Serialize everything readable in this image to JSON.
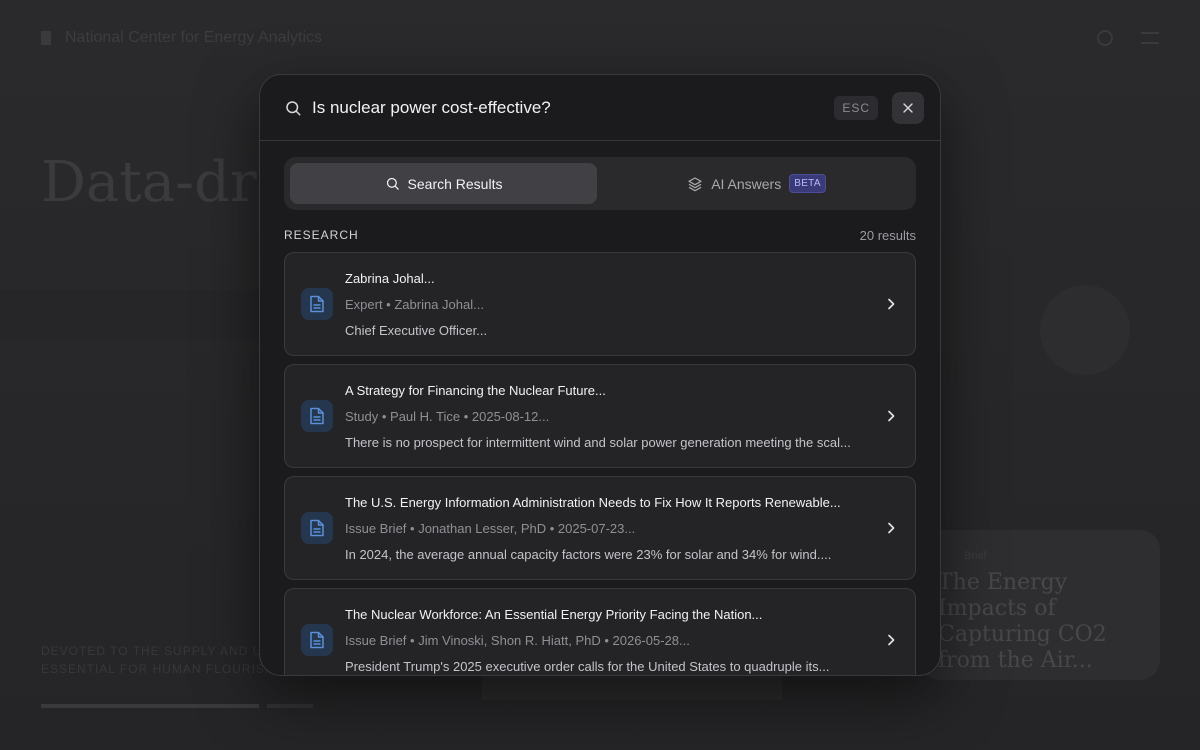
{
  "background": {
    "site_name": "National Center for Energy Analytics",
    "hero_title": "Data-driven policies, p",
    "tagline_line1": "DEVOTED TO THE SUPPLY AND USE",
    "tagline_line2": "ESSENTIAL FOR HUMAN FLOURISHI",
    "card_kicker": "Brief",
    "card_title": "The Energy Impacts of Capturing CO2 from the Air..."
  },
  "search": {
    "query": "Is nuclear power cost-effective?",
    "esc_label": "ESC"
  },
  "tabs": [
    {
      "label": "Search Results",
      "icon": "search-icon",
      "active": true
    },
    {
      "label": "AI Answers",
      "icon": "layers-icon",
      "badge": "BETA",
      "active": false
    }
  ],
  "section": {
    "title": "RESEARCH",
    "count": "20 results"
  },
  "results": [
    {
      "title": "Zabrina Johal...",
      "meta": "Expert • Zabrina Johal...",
      "snippet": "Chief Executive Officer..."
    },
    {
      "title": "A Strategy for Financing the Nuclear Future...",
      "meta": "Study • Paul H. Tice • 2025-08-12...",
      "snippet": "There is no prospect for intermittent wind and solar power generation meeting the scal..."
    },
    {
      "title": "The U.S. Energy Information Administration Needs to Fix How It Reports Renewable...",
      "meta": "Issue Brief • Jonathan Lesser, PhD • 2025-07-23...",
      "snippet": "In 2024, the average annual capacity factors were 23% for solar and 34% for wind...."
    },
    {
      "title": "The Nuclear Workforce: An Essential Energy Priority Facing the Nation...",
      "meta": "Issue Brief • Jim Vinoski, Shon R. Hiatt, PhD • 2026-05-28...",
      "snippet": "President Trump's 2025 executive order calls for the United States to quadruple its..."
    }
  ],
  "colors": {
    "accent_icon": "#5b8fd6",
    "beta_badge": "#3b3a78"
  }
}
